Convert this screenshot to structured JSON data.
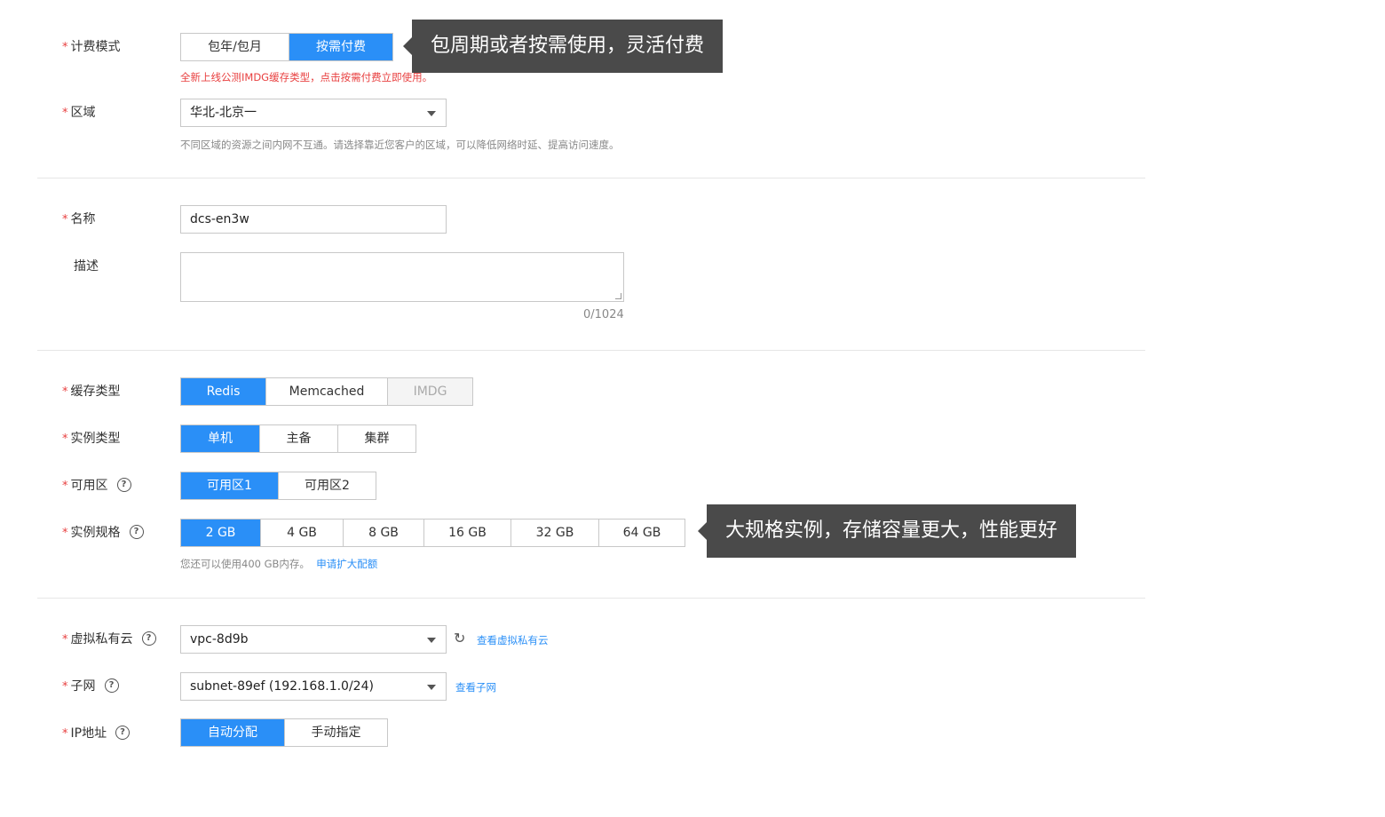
{
  "billing": {
    "label": "计费模式",
    "options": [
      "包年/包月",
      "按需付费"
    ],
    "active": 1,
    "warning": "全新上线公测IMDG缓存类型，点击按需付费立即使用。",
    "tooltip": "包周期或者按需使用，灵活付费"
  },
  "region": {
    "label": "区域",
    "value": "华北-北京一",
    "hint": "不同区域的资源之间内网不互通。请选择靠近您客户的区域，可以降低网络时延、提高访问速度。"
  },
  "name": {
    "label": "名称",
    "value": "dcs-en3w"
  },
  "description": {
    "label": "描述",
    "value": "",
    "counter": "0/1024"
  },
  "cache_type": {
    "label": "缓存类型",
    "options": [
      "Redis",
      "Memcached",
      "IMDG"
    ],
    "active": 0
  },
  "instance_type": {
    "label": "实例类型",
    "options": [
      "单机",
      "主备",
      "集群"
    ],
    "active": 0
  },
  "az": {
    "label": "可用区",
    "options": [
      "可用区1",
      "可用区2"
    ],
    "active": 0
  },
  "spec": {
    "label": "实例规格",
    "options": [
      "2 GB",
      "4 GB",
      "8 GB",
      "16 GB",
      "32 GB",
      "64 GB"
    ],
    "active": 0,
    "hint": "您还可以使用400 GB内存。",
    "link": "申请扩大配额",
    "tooltip": "大规格实例，存储容量更大，性能更好"
  },
  "vpc": {
    "label": "虚拟私有云",
    "value": "vpc-8d9b",
    "link": "查看虚拟私有云"
  },
  "subnet": {
    "label": "子网",
    "value": "subnet-89ef (192.168.1.0/24)",
    "link": "查看子网"
  },
  "ip": {
    "label": "IP地址",
    "options": [
      "自动分配",
      "手动指定"
    ],
    "active": 0
  },
  "icons": {
    "required": "*",
    "help": "?",
    "refresh": "↻"
  }
}
